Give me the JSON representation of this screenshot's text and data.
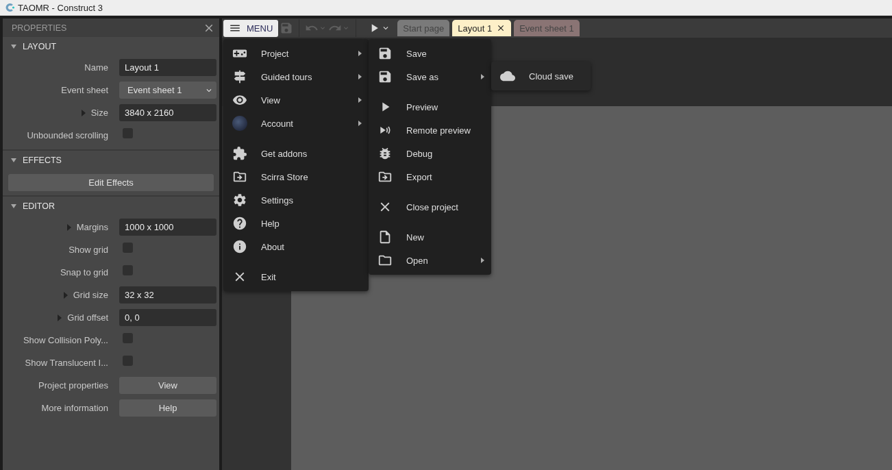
{
  "window": {
    "title": "TAOMR - Construct 3"
  },
  "properties": {
    "title": "PROPERTIES",
    "sections": [
      {
        "title": "LAYOUT",
        "expanded": true,
        "rows": [
          {
            "kind": "text",
            "label": "Name",
            "value": "Layout 1",
            "expandable": false
          },
          {
            "kind": "select",
            "label": "Event sheet",
            "value": "Event sheet 1",
            "expandable": false
          },
          {
            "kind": "text",
            "label": "Size",
            "value": "3840 x 2160",
            "expandable": true
          },
          {
            "kind": "checkbox",
            "label": "Unbounded scrolling",
            "checked": false,
            "expandable": false
          }
        ]
      },
      {
        "title": "EFFECTS",
        "expanded": true,
        "rows": [
          {
            "kind": "wide-button",
            "value": "Edit Effects"
          }
        ]
      },
      {
        "title": "EDITOR",
        "expanded": true,
        "rows": [
          {
            "kind": "text",
            "label": "Margins",
            "value": "1000 x 1000",
            "expandable": true
          },
          {
            "kind": "checkbox",
            "label": "Show grid",
            "checked": false,
            "expandable": false
          },
          {
            "kind": "checkbox",
            "label": "Snap to grid",
            "checked": false,
            "expandable": false
          },
          {
            "kind": "text",
            "label": "Grid size",
            "value": "32 x 32",
            "expandable": true
          },
          {
            "kind": "text",
            "label": "Grid offset",
            "value": "0, 0",
            "expandable": true
          },
          {
            "kind": "checkbox",
            "label": "Show Collision Poly...",
            "checked": false,
            "expandable": false
          },
          {
            "kind": "checkbox",
            "label": "Show Translucent I...",
            "checked": false,
            "expandable": false
          },
          {
            "kind": "button",
            "label": "Project properties",
            "value": "View",
            "expandable": false
          },
          {
            "kind": "button",
            "label": "More information",
            "value": "Help",
            "expandable": false
          }
        ]
      }
    ]
  },
  "toolbar": {
    "menu_button": "MENU",
    "tabs": [
      {
        "label": "Start page",
        "selected": false,
        "closable": false,
        "color": "#7a7a7a"
      },
      {
        "label": "Layout 1",
        "selected": true,
        "closable": true,
        "color": "#fdf0c8"
      },
      {
        "label": "Event sheet 1",
        "selected": false,
        "closable": false,
        "color": "#8a7474"
      }
    ]
  },
  "main_menu": {
    "groups": [
      [
        {
          "label": "Project",
          "submenu": true
        },
        {
          "label": "Guided tours",
          "submenu": true
        },
        {
          "label": "View",
          "submenu": true
        },
        {
          "label": "Account",
          "submenu": true
        }
      ],
      [
        {
          "label": "Get addons",
          "submenu": false
        },
        {
          "label": "Scirra Store",
          "submenu": false
        },
        {
          "label": "Settings",
          "submenu": false
        },
        {
          "label": "Help",
          "submenu": false
        },
        {
          "label": "About",
          "submenu": false
        }
      ],
      [
        {
          "label": "Exit",
          "submenu": false
        }
      ]
    ]
  },
  "project_menu": {
    "groups": [
      [
        {
          "label": "Save",
          "submenu": false
        },
        {
          "label": "Save as",
          "submenu": true
        }
      ],
      [
        {
          "label": "Preview",
          "submenu": false
        },
        {
          "label": "Remote preview",
          "submenu": false
        },
        {
          "label": "Debug",
          "submenu": false
        },
        {
          "label": "Export",
          "submenu": false
        }
      ],
      [
        {
          "label": "Close project",
          "submenu": false
        }
      ],
      [
        {
          "label": "New",
          "submenu": false
        },
        {
          "label": "Open",
          "submenu": true
        }
      ]
    ]
  },
  "save_as_menu": {
    "groups": [
      [
        {
          "label": "Cloud save",
          "submenu": false
        }
      ]
    ]
  }
}
